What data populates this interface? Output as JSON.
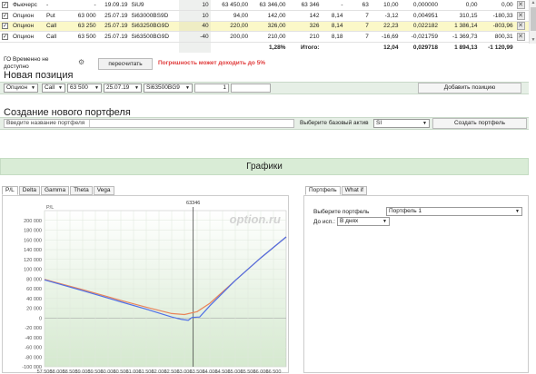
{
  "positions": {
    "rows": [
      {
        "checked": true,
        "type": "Фьючерс",
        "opt": "-",
        "strike": "-",
        "exp": "19.09.19",
        "code": "SiU9",
        "qty": "10",
        "price": "63 450,00",
        "theor": "63 346,00",
        "iv": "63 346",
        "c10": "-",
        "days": "63",
        "pl": "10,00",
        "delta": "0,000000",
        "c14": "0,00",
        "c15": "0,00",
        "highlight": false
      },
      {
        "checked": true,
        "type": "Опцион",
        "opt": "Put",
        "strike": "63 000",
        "exp": "25.07.19",
        "code": "Si63000BS9D",
        "qty": "10",
        "price": "94,00",
        "theor": "142,00",
        "iv": "142",
        "c10": "8,14",
        "days": "7",
        "pl": "-3,12",
        "delta": "0,004951",
        "c14": "310,15",
        "c15": "-180,33",
        "highlight": false
      },
      {
        "checked": true,
        "type": "Опцион",
        "opt": "Call",
        "strike": "63 250",
        "exp": "25.07.19",
        "code": "Si63250BG9D",
        "qty": "40",
        "price": "220,00",
        "theor": "326,00",
        "iv": "326",
        "c10": "8,14",
        "days": "7",
        "pl": "22,23",
        "delta": "0,022182",
        "c14": "1 386,14",
        "c15": "-803,96",
        "highlight": true
      },
      {
        "checked": true,
        "type": "Опцион",
        "opt": "Call",
        "strike": "63 500",
        "exp": "25.07.19",
        "code": "Si63500BG9D",
        "qty": "-40",
        "price": "200,00",
        "theor": "210,00",
        "iv": "210",
        "c10": "8,18",
        "days": "7",
        "pl": "-16,69",
        "delta": "-0,021759",
        "c14": "-1 369,73",
        "c15": "800,31",
        "highlight": false
      }
    ],
    "totals": {
      "label": "Итого:",
      "pct": "1,28%",
      "pl": "12,04",
      "delta": "0,029718",
      "c14": "1 894,13",
      "c15": "-1 120,99"
    },
    "delete_glyph": "✕",
    "check_glyph": "✓"
  },
  "recalc": {
    "go_label": "ГО Временно не доступно",
    "button": "пересчитать",
    "warning": "Погрешность может доходить до 5%"
  },
  "new_position": {
    "title": "Новая позиция",
    "type": "Опцион",
    "opt": "Call",
    "strike": "63 500",
    "exp": "25.07.19",
    "code": "Si63500BG9",
    "qty": "1",
    "add_button": "Добавить позицию"
  },
  "portfolio_create": {
    "title": "Создание нового портфеля",
    "name_placeholder": "Введите название портфеля",
    "base_label": "Выберите базовый актив",
    "base_value": "SI",
    "button": "Создать портфель"
  },
  "graphs": {
    "title": "Графики",
    "tabs": [
      "P/L",
      "Delta",
      "Gamma",
      "Theta",
      "Vega"
    ],
    "active_tab": "P/L",
    "watermark": "option.ru",
    "ylabel": "P/L",
    "marker_label": "63346"
  },
  "side": {
    "tabs": [
      "Портфель",
      "What if"
    ],
    "active_tab": "Портфель",
    "portfolio_label": "Выберите портфель",
    "portfolio_value": "Портфель 1",
    "exp_label": "До исп.:",
    "exp_value": "В днях"
  },
  "chart_data": {
    "type": "line",
    "ylabel": "P/L",
    "xlim": [
      57500,
      67000
    ],
    "ylim": [
      -100000,
      220000
    ],
    "x_ticks": [
      "57 500",
      "58 000",
      "58 500",
      "59 000",
      "59 500",
      "60 000",
      "60 500",
      "61 000",
      "61 500",
      "62 000",
      "62 500",
      "63 000",
      "63 500",
      "64 000",
      "64 500",
      "65 000",
      "65 500",
      "66 000",
      "66 500"
    ],
    "y_ticks": [
      "200 000",
      "180 000",
      "160 000",
      "140 000",
      "120 000",
      "100 000",
      "80 000",
      "60 000",
      "40 000",
      "20 000",
      "0",
      "-20 000",
      "-40 000",
      "-60 000",
      "-80 000",
      "-100 000"
    ],
    "marker_x": 63346,
    "series": [
      {
        "name": "",
        "color": "#e8845a",
        "x": [
          57500,
          59000,
          60500,
          61500,
          62500,
          63000,
          63500,
          64000,
          65000,
          66000,
          67000
        ],
        "y": [
          79000,
          58000,
          36000,
          22000,
          9000,
          7000,
          13000,
          30000,
          77000,
          123000,
          166000
        ]
      },
      {
        "name": "",
        "color": "#4f6fe6",
        "x": [
          57500,
          59000,
          60500,
          61500,
          62500,
          62900,
          63150,
          63300,
          63600,
          64000,
          65000,
          66000,
          67000
        ],
        "y": [
          78000,
          56000,
          33000,
          18000,
          2000,
          -3000,
          -5000,
          1000,
          2000,
          25000,
          77000,
          123000,
          166000
        ]
      }
    ]
  }
}
